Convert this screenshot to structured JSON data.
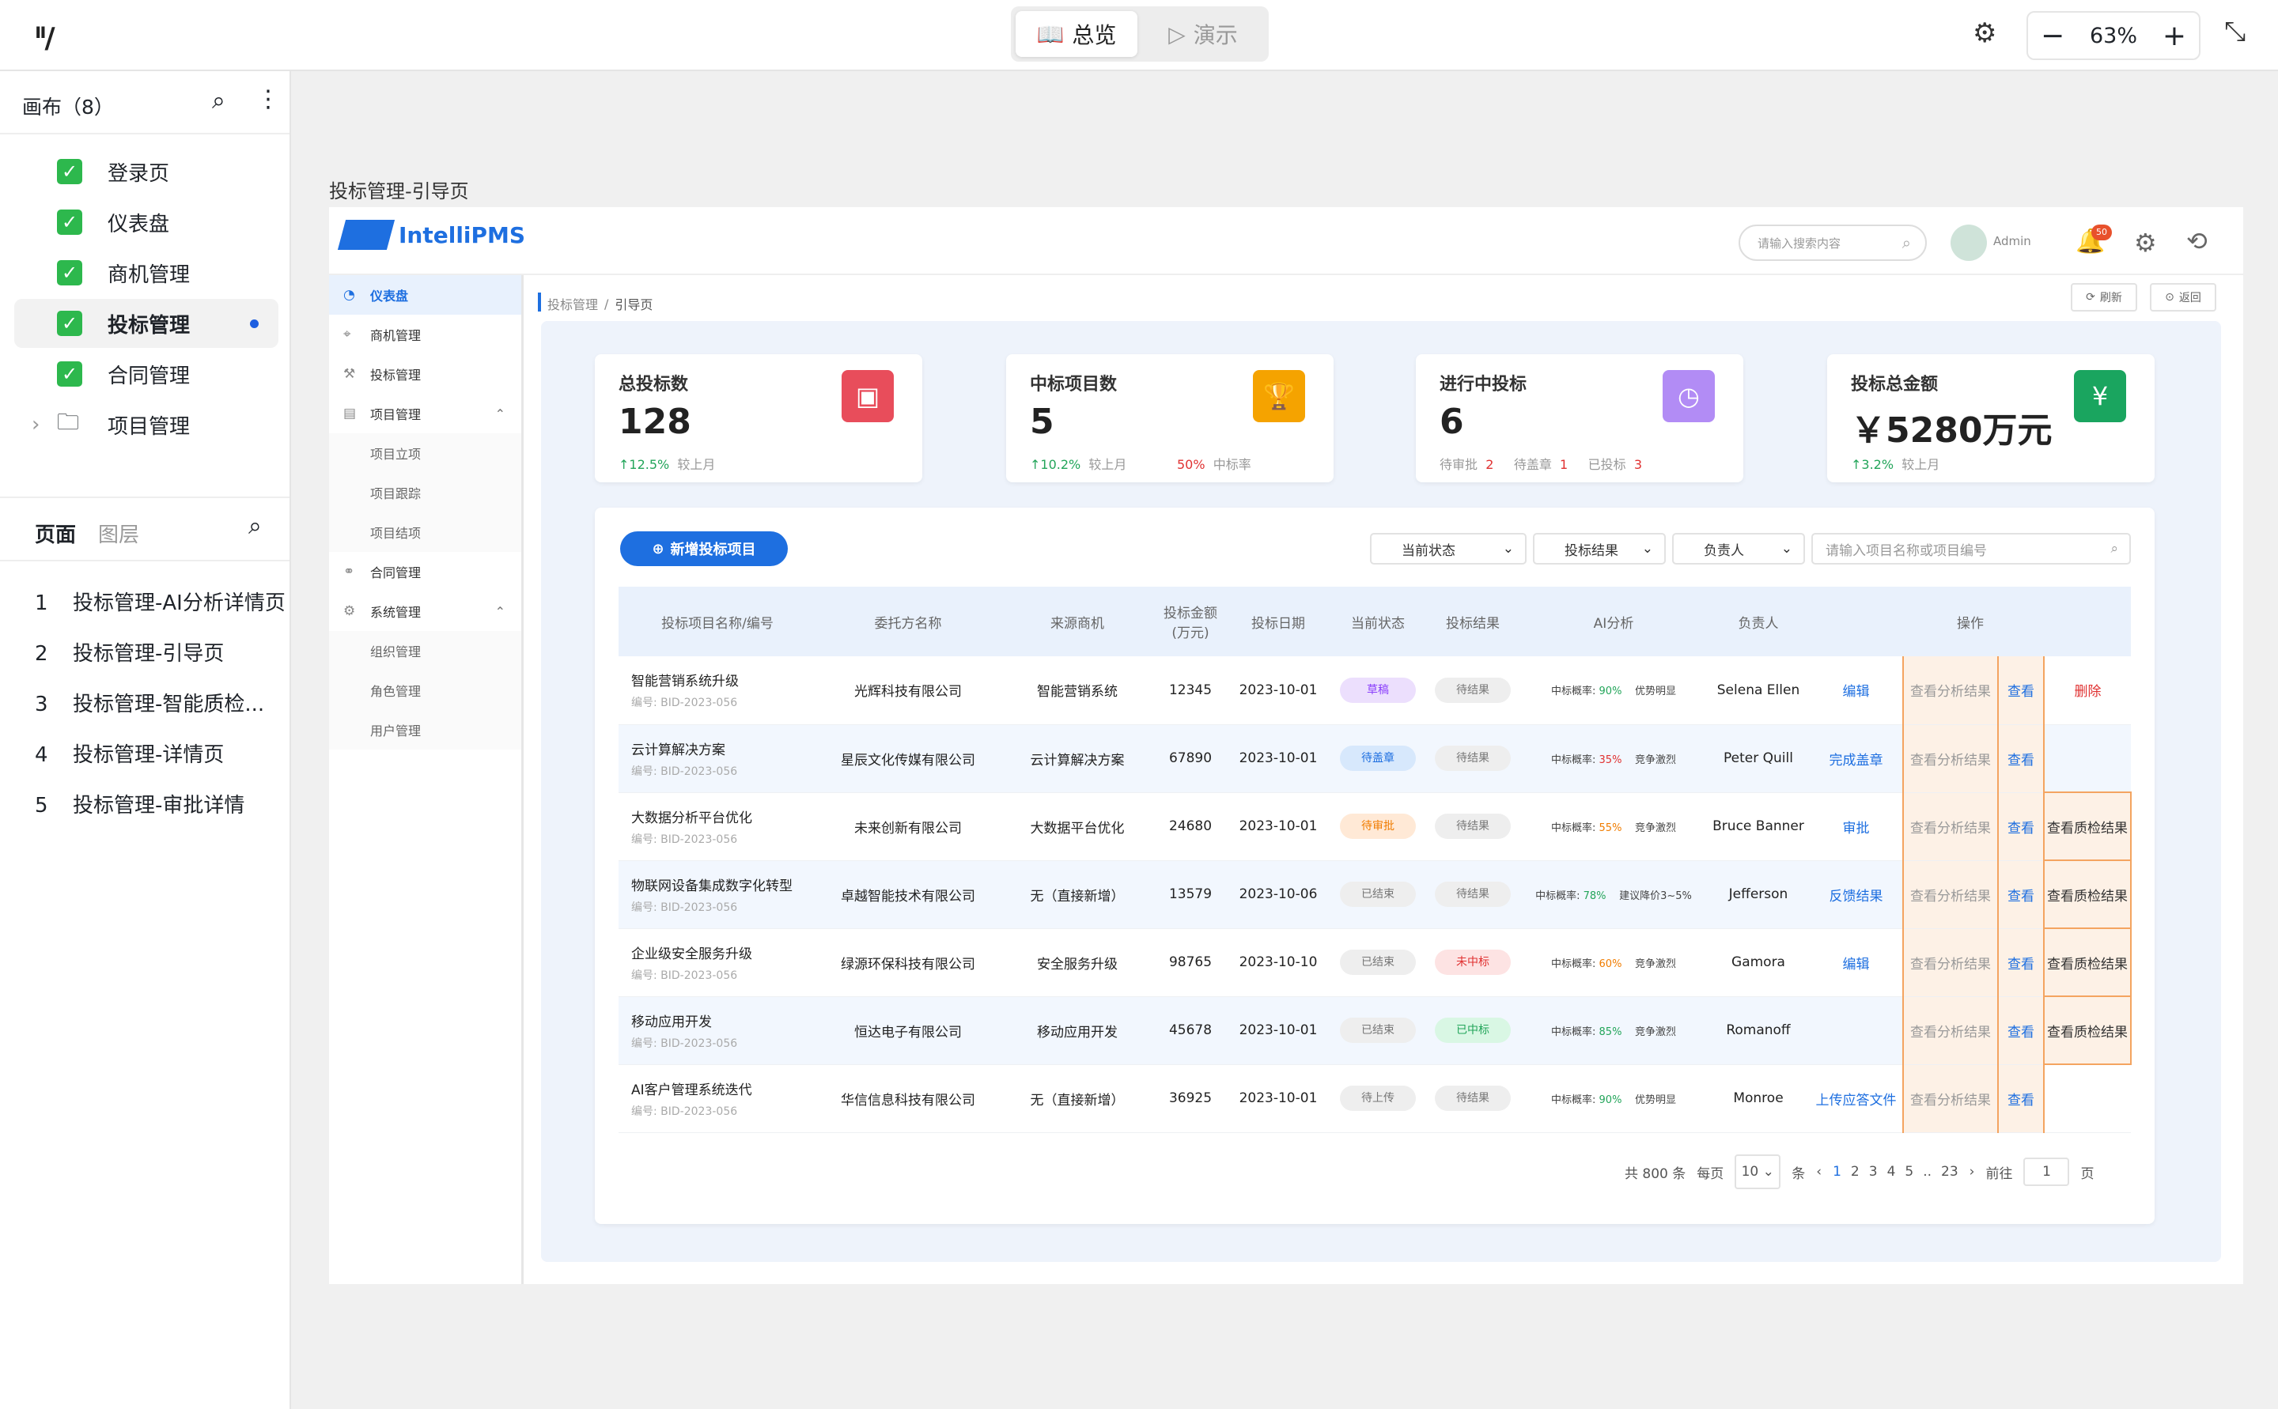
{
  "toolbar": {
    "mode_overview": "总览",
    "mode_present": "演示",
    "zoom": "63%"
  },
  "left_panel": {
    "canvas_title": "画布（8）",
    "canvas_items": [
      {
        "label": "登录页"
      },
      {
        "label": "仪表盘"
      },
      {
        "label": "商机管理"
      },
      {
        "label": "投标管理"
      },
      {
        "label": "合同管理"
      },
      {
        "label": "项目管理"
      }
    ],
    "tab_pages": "页面",
    "tab_layers": "图层",
    "pages": [
      {
        "num": "1",
        "label": "投标管理-AI分析详情页"
      },
      {
        "num": "2",
        "label": "投标管理-引导页"
      },
      {
        "num": "3",
        "label": "投标管理-智能质检..."
      },
      {
        "num": "4",
        "label": "投标管理-详情页"
      },
      {
        "num": "5",
        "label": "投标管理-审批详情"
      }
    ]
  },
  "frame": {
    "title": "投标管理-引导页"
  },
  "app": {
    "brand": "IntelliPMS",
    "search_placeholder": "请输入搜索内容",
    "user": "Admin",
    "notif_count": "50",
    "breadcrumb_root": "投标管理",
    "breadcrumb_current": "引导页",
    "refresh": "刷新",
    "back": "返回",
    "menu": [
      {
        "label": "仪表盘"
      },
      {
        "label": "商机管理"
      },
      {
        "label": "投标管理"
      },
      {
        "label": "项目管理"
      },
      {
        "label": "项目立项"
      },
      {
        "label": "项目跟踪"
      },
      {
        "label": "项目结项"
      },
      {
        "label": "合同管理"
      },
      {
        "label": "系统管理"
      },
      {
        "label": "组织管理"
      },
      {
        "label": "角色管理"
      },
      {
        "label": "用户管理"
      }
    ],
    "stats": [
      {
        "label": "总投标数",
        "value": "128",
        "delta": "↑12.5%",
        "delta_note": "较上月",
        "color": "#e84d5b"
      },
      {
        "label": "中标项目数",
        "value": "5",
        "delta": "↑10.2%",
        "delta_note": "较上月",
        "extra_val": "50%",
        "extra_note": "中标率",
        "color": "#f5a300"
      },
      {
        "label": "进行中投标",
        "value": "6",
        "s1": "待审批",
        "v1": "2",
        "s2": "待盖章",
        "v2": "1",
        "s3": "已投标",
        "v3": "3",
        "color": "#b28cf5"
      },
      {
        "label": "投标总金额",
        "value": "￥5280万元",
        "delta": "↑3.2%",
        "delta_note": "较上月",
        "color": "#1aa55f"
      }
    ],
    "new_button": "新增投标项目",
    "filters": {
      "status": "当前状态",
      "result": "投标结果",
      "owner": "负责人",
      "search_placeholder": "请输入项目名称或项目编号"
    },
    "table": {
      "headers": [
        "投标项目名称/编号",
        "委托方名称",
        "来源商机",
        "投标金额(万元)",
        "投标日期",
        "当前状态",
        "投标结果",
        "AI分析",
        "负责人",
        "操作"
      ],
      "rows": [
        {
          "name": "智能营销系统升级",
          "code": "编号: BID-2023-056",
          "client": "光辉科技有限公司",
          "source": "智能营销系统",
          "amount": "12345",
          "date": "2023-10-01",
          "status": "草稿",
          "status_c": "purple",
          "result": "待结果",
          "result_c": "gray",
          "prob_label": "中标概率:",
          "prob": "90%",
          "prob_c": "#23a55a",
          "ai_note": "优势明显",
          "owner": "Selena Ellen",
          "act1": "编辑",
          "act2": "查看分析结果",
          "act3": "查看",
          "act4": "删除"
        },
        {
          "name": "云计算解决方案",
          "code": "编号: BID-2023-056",
          "client": "星辰文化传媒有限公司",
          "source": "云计算解决方案",
          "amount": "67890",
          "date": "2023-10-01",
          "status": "待盖章",
          "status_c": "blue",
          "result": "待结果",
          "result_c": "gray",
          "prob_label": "中标概率:",
          "prob": "35%",
          "prob_c": "#e03131",
          "ai_note": "竞争激烈",
          "owner": "Peter Quill",
          "act1": "完成盖章",
          "act2": "查看分析结果",
          "act3": "查看",
          "act4": ""
        },
        {
          "name": "大数据分析平台优化",
          "code": "编号: BID-2023-056",
          "client": "未来创新有限公司",
          "source": "大数据平台优化",
          "amount": "24680",
          "date": "2023-10-01",
          "status": "待审批",
          "status_c": "orange",
          "result": "待结果",
          "result_c": "gray",
          "prob_label": "中标概率:",
          "prob": "55%",
          "prob_c": "#f07c00",
          "ai_note": "竞争激烈",
          "owner": "Bruce Banner",
          "act1": "审批",
          "act2": "查看分析结果",
          "act3": "查看",
          "act4": "查看质检结果"
        },
        {
          "name": "物联网设备集成数字化转型",
          "code": "编号: BID-2023-056",
          "client": "卓越智能技术有限公司",
          "source": "无（直接新增）",
          "amount": "13579",
          "date": "2023-10-06",
          "status": "已结束",
          "status_c": "gray",
          "result": "待结果",
          "result_c": "gray",
          "prob_label": "中标概率:",
          "prob": "78%",
          "prob_c": "#23a55a",
          "ai_note": "建议降价3~5%",
          "owner": "Jefferson",
          "act1": "反馈结果",
          "act2": "查看分析结果",
          "act3": "查看",
          "act4": "查看质检结果"
        },
        {
          "name": "企业级安全服务升级",
          "code": "编号: BID-2023-056",
          "client": "绿源环保科技有限公司",
          "source": "安全服务升级",
          "amount": "98765",
          "date": "2023-10-10",
          "status": "已结束",
          "status_c": "gray",
          "result": "未中标",
          "result_c": "red",
          "prob_label": "中标概率:",
          "prob": "60%",
          "prob_c": "#f07c00",
          "ai_note": "竞争激烈",
          "owner": "Gamora",
          "act1": "编辑",
          "act2": "查看分析结果",
          "act3": "查看",
          "act4": "查看质检结果"
        },
        {
          "name": "移动应用开发",
          "code": "编号: BID-2023-056",
          "client": "恒达电子有限公司",
          "source": "移动应用开发",
          "amount": "45678",
          "date": "2023-10-01",
          "status": "已结束",
          "status_c": "gray",
          "result": "已中标",
          "result_c": "green",
          "prob_label": "中标概率:",
          "prob": "85%",
          "prob_c": "#23a55a",
          "ai_note": "竞争激烈",
          "owner": "Romanoff",
          "act1": "",
          "act2": "查看分析结果",
          "act3": "查看",
          "act4": "查看质检结果"
        },
        {
          "name": "AI客户管理系统迭代",
          "code": "编号: BID-2023-056",
          "client": "华信信息科技有限公司",
          "source": "无（直接新增）",
          "amount": "36925",
          "date": "2023-10-01",
          "status": "待上传",
          "status_c": "gray",
          "result": "待结果",
          "result_c": "gray",
          "prob_label": "中标概率:",
          "prob": "90%",
          "prob_c": "#23a55a",
          "ai_note": "优势明显",
          "owner": "Monroe",
          "act1": "上传应答文件",
          "act2": "查看分析结果",
          "act3": "查看",
          "act4": ""
        }
      ]
    },
    "pagination": {
      "total": "共 800 条",
      "per_page_label": "每页",
      "per_page": "10",
      "unit": "条",
      "pages": [
        "1",
        "2",
        "3",
        "4",
        "5",
        "..",
        "23"
      ],
      "goto": "前往",
      "goto_value": "1",
      "page_unit": "页"
    }
  }
}
